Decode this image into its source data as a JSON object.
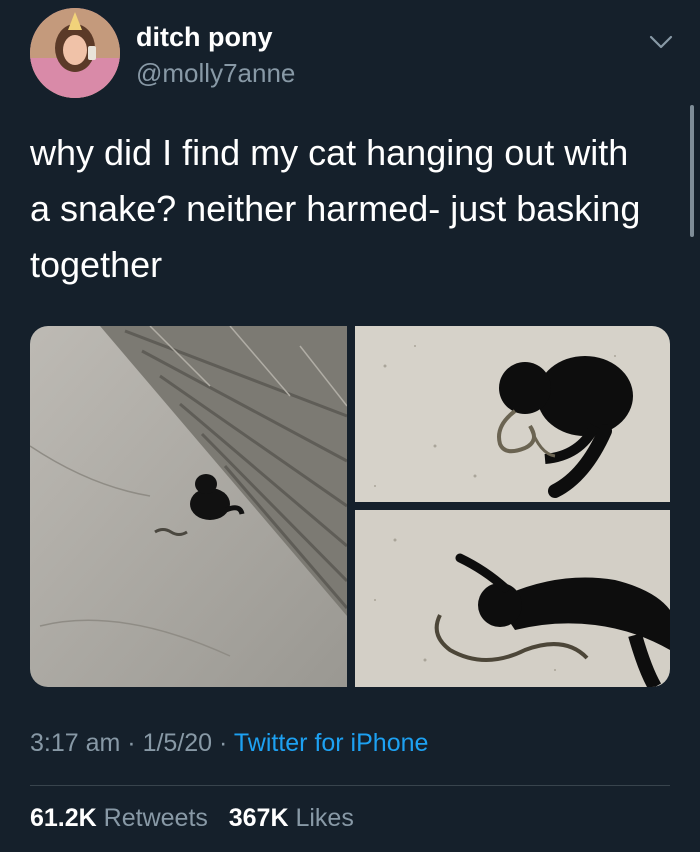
{
  "user": {
    "name": "ditch pony",
    "handle": "@molly7anne"
  },
  "tweet": {
    "text_lines": [
      "why did I find my cat hanging out with",
      "a snake? neither harmed- just basking",
      "together"
    ]
  },
  "photos": [
    "cat-with-snake-on-sidewalk",
    "cat-curled-with-snake",
    "cat-stretched-with-snake"
  ],
  "meta": {
    "time": "3:17 am",
    "date": "1/5/20",
    "source": "Twitter for iPhone",
    "sep": "·"
  },
  "stats": {
    "retweets": "61.2K",
    "retweets_label": "Retweets",
    "likes": "367K",
    "likes_label": "Likes"
  },
  "colors": {
    "background": "#15202b",
    "secondary": "#8899a6",
    "link": "#1da1f2",
    "divider": "#38444d"
  }
}
